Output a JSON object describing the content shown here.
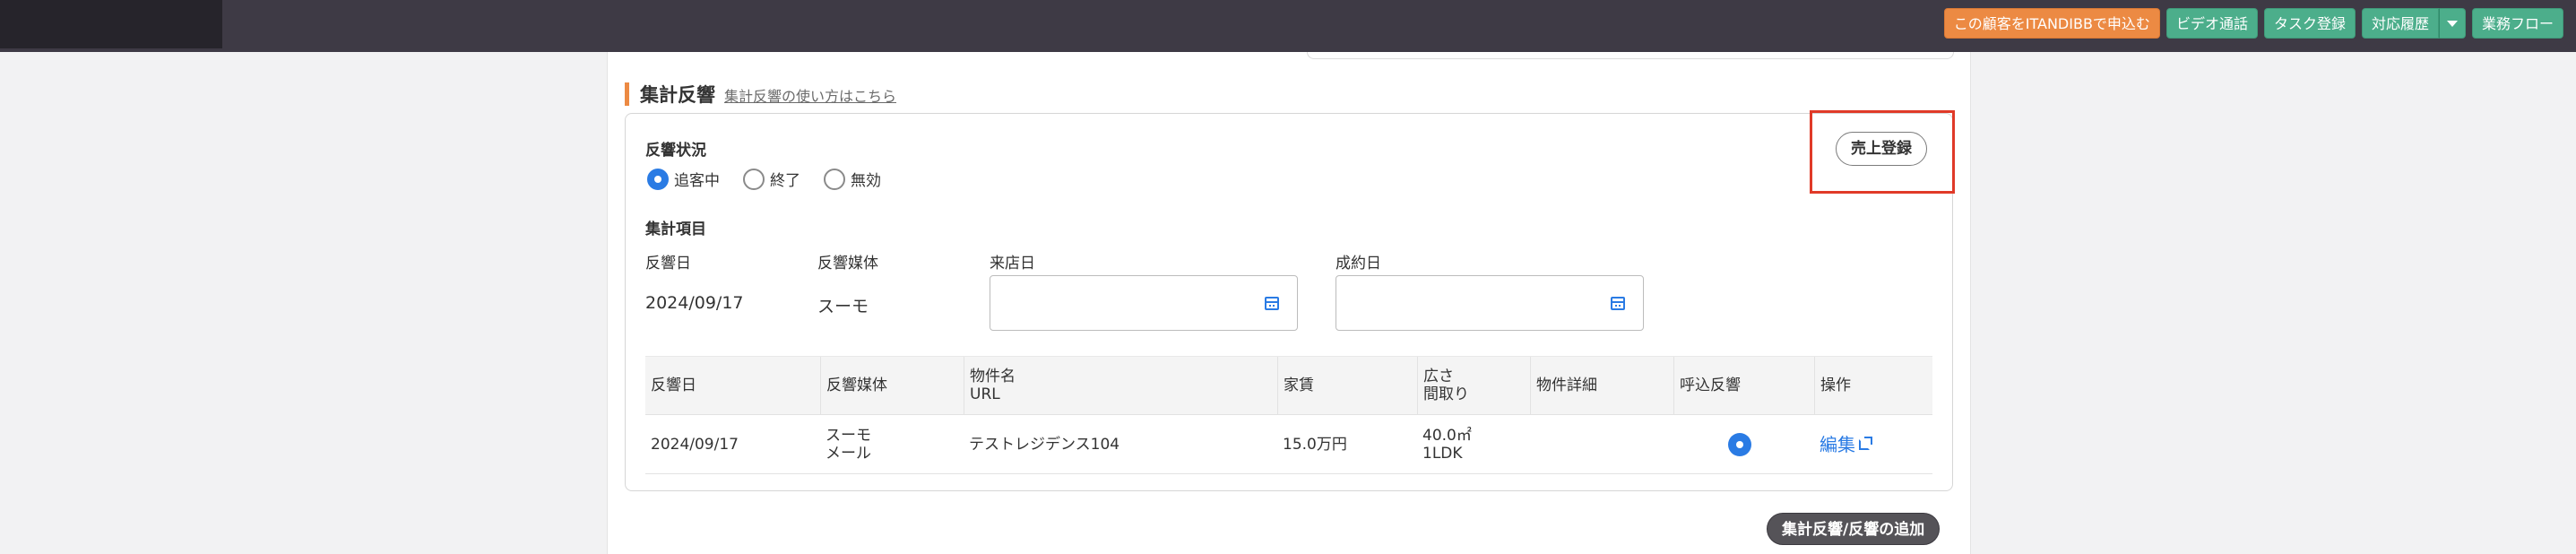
{
  "header": {
    "buttons": {
      "apply_itandibb": "この顧客をITANDIBBで申込む",
      "video_call": "ビデオ通話",
      "task_register": "タスク登録",
      "history": "対応履歴",
      "workflow": "業務フロー"
    },
    "colors": {
      "bar": "#3e3a45",
      "orange": "#ec8a43",
      "green": "#4cae8b"
    }
  },
  "section": {
    "title": "集計反響",
    "help_link": "集計反響の使い方はこちら",
    "accent_color": "#ec8a43"
  },
  "status": {
    "label": "反響状況",
    "options": [
      "追客中",
      "終了",
      "無効"
    ],
    "selected": "追客中"
  },
  "sales_button": "売上登録",
  "fields": {
    "label": "集計項目",
    "response_date_label": "反響日",
    "response_date_value": "2024/09/17",
    "media_label": "反響媒体",
    "media_value": "スーモ",
    "visit_date_label": "来店日",
    "contract_date_label": "成約日"
  },
  "table": {
    "headers": {
      "date": "反響日",
      "media": "反響媒体",
      "property": "物件名",
      "url": "URL",
      "rent": "家賃",
      "area": "広さ",
      "layout": "間取り",
      "detail": "物件詳細",
      "call": "呼込反響",
      "action": "操作"
    },
    "rows": [
      {
        "date": "2024/09/17",
        "media": "スーモ",
        "media_sub": "メール",
        "property": "テストレジデンス104",
        "rent": "15.0万円",
        "area": "40.0㎡",
        "layout": "1LDK",
        "call_selected": true,
        "action": "編集"
      }
    ]
  },
  "add_button": "集計反響/反響の追加"
}
